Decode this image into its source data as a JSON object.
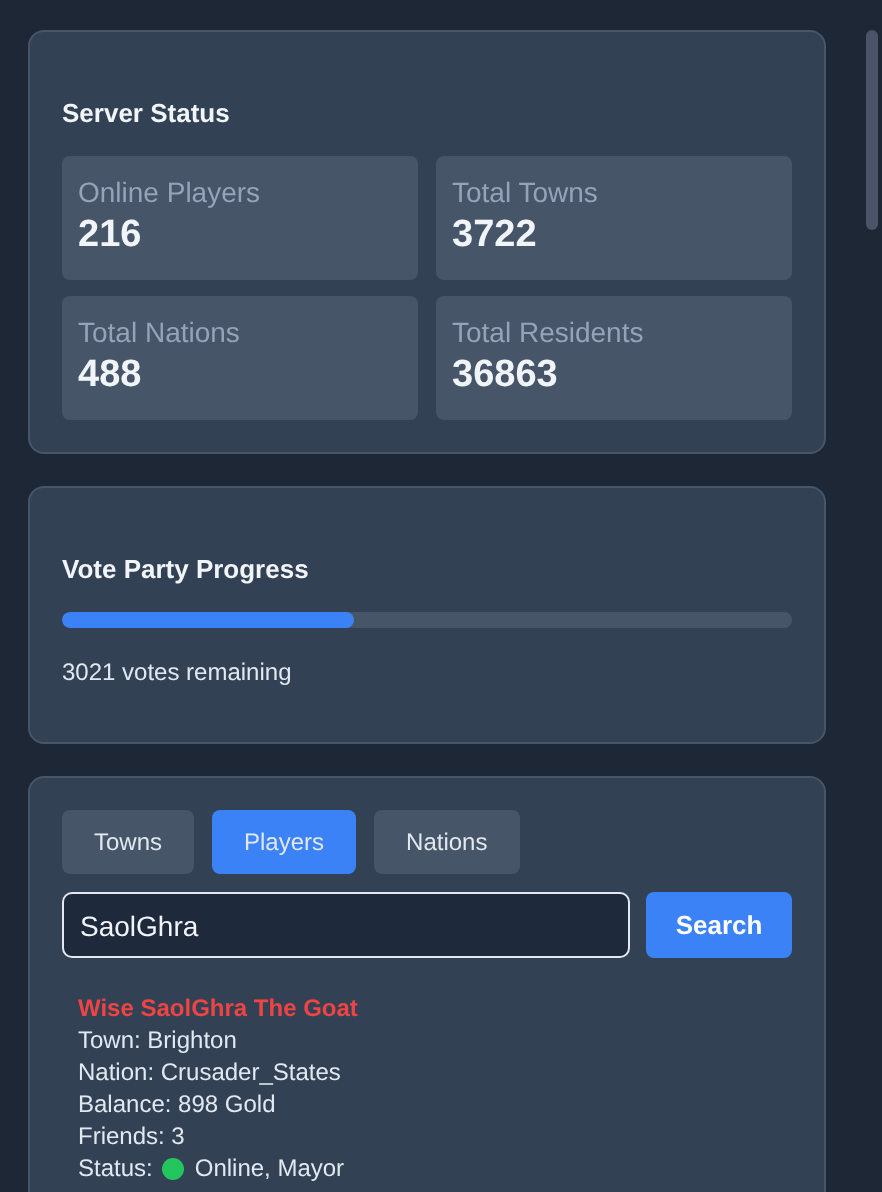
{
  "server_status": {
    "title": "Server Status",
    "stats": [
      {
        "label": "Online Players",
        "value": "216"
      },
      {
        "label": "Total Towns",
        "value": "3722"
      },
      {
        "label": "Total Nations",
        "value": "488"
      },
      {
        "label": "Total Residents",
        "value": "36863"
      }
    ]
  },
  "vote_party": {
    "title": "Vote Party Progress",
    "level": 0.4,
    "remaining": "3021 votes remaining"
  },
  "search": {
    "tabs": [
      {
        "label": "Towns",
        "selected": false
      },
      {
        "label": "Players",
        "selected": true
      },
      {
        "label": "Nations",
        "selected": false
      }
    ],
    "value": "SaolGhra",
    "button": "Search",
    "result": {
      "name": "Wise SaolGhra The Goat",
      "lines": [
        {
          "kind": "text",
          "text": "Town: Brighton"
        },
        {
          "kind": "text",
          "text": "Nation: Crusader_States"
        },
        {
          "kind": "text",
          "text": "Balance: 898 Gold"
        },
        {
          "kind": "text",
          "text": "Friends: 3"
        },
        {
          "kind": "status",
          "label": "Status:",
          "online": true,
          "text": "Online, Mayor"
        }
      ]
    }
  }
}
